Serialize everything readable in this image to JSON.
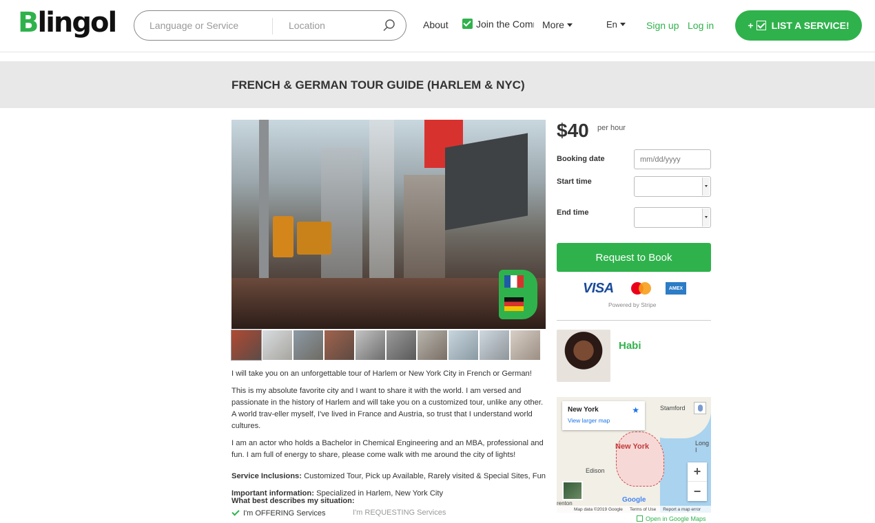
{
  "header": {
    "logo": "Blingol",
    "search_language_placeholder": "Language or Service",
    "search_location_placeholder": "Location",
    "nav": {
      "about": "About",
      "join": "Join the Community",
      "more": "More",
      "lang": "En",
      "signup": "Sign up",
      "login": "Log in"
    },
    "list_service": "LIST A SERVICE!",
    "list_service_prefix": "+"
  },
  "listing": {
    "title": "FRENCH & GERMAN TOUR GUIDE (HARLEM & NYC)",
    "description": [
      "I will take you on an unforgettable tour of Harlem or New York City in French or German!",
      "This is my absolute favorite city and I want to share it with the world. I am versed and passionate in the history of Harlem and will take you on a customized tour, unlike any other. A world trav-eller myself, I've lived in France and Austria, so trust that I understand world cultures.",
      "I am an actor who holds a Bachelor in Chemical Engineering and an MBA, professional and fun. I am full of energy to share, please come walk with me around the city of lights!"
    ],
    "inclusions_label": "Service Inclusions:",
    "inclusions": "Customized Tour, Pick up Available, Rarely visited & Special Sites, Fun",
    "important_label": "Important information:",
    "important": "Specialized in Harlem, New York City",
    "situation_label": "What best describes my situation:",
    "situation_selected": "I'm OFFERING Services",
    "situation_other": "I'm REQUESTING Services",
    "thumbnail_count": 10
  },
  "booking": {
    "price": "$40",
    "per": "per hour",
    "booking_date_label": "Booking date",
    "date_placeholder": "mm/dd/yyyy",
    "start_time_label": "Start time",
    "end_time_label": "End time",
    "request_button": "Request to Book",
    "visa": "VISA",
    "amex": "AMEX",
    "powered_by": "Powered by Stripe"
  },
  "host": {
    "name": "Habi"
  },
  "map": {
    "place": "New York",
    "view_larger": "View larger map",
    "label_stamford": "Stamford",
    "label_newyork": "New York",
    "label_edison": "Edison",
    "label_long": "Long I",
    "label_renton": "renton",
    "google": "Google",
    "map_data": "Map data ©2019 Google",
    "terms": "Terms of Use",
    "report": "Report a map error",
    "zoom_in": "+",
    "zoom_out": "−",
    "open_google_maps": "Open in Google Maps"
  },
  "colors": {
    "brand_green": "#2fb24c"
  }
}
